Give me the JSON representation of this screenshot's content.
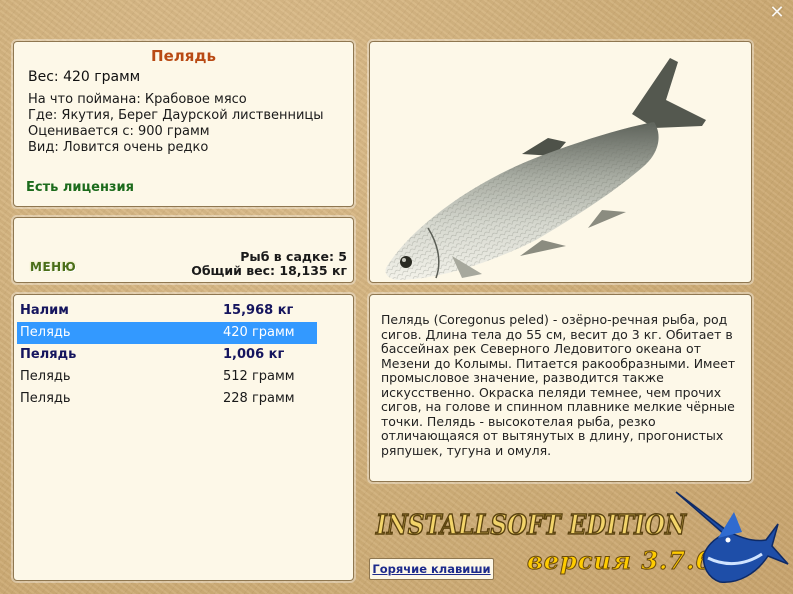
{
  "window": {
    "close_symbol": "✕"
  },
  "info": {
    "title": "Пелядь",
    "weight": "Вес: 420 грамм",
    "details": [
      "На что поймана: Крабовое мясо",
      "Где: Якутия, Берег Даурской лиственницы",
      "Оценивается с: 900 грамм",
      "Вид: Ловится очень редко"
    ],
    "license": "Есть лицензия"
  },
  "menu": {
    "button_label": "МЕНЮ",
    "fish_in_keepnet": "Рыб в садке: 5",
    "total_weight": "Общий вес: 18,135 кг"
  },
  "catch_list": [
    {
      "name": "Налим",
      "weight": "15,968 кг",
      "bold": true,
      "selected": false
    },
    {
      "name": "Пелядь",
      "weight": "420 грамм",
      "bold": false,
      "selected": true
    },
    {
      "name": "Пелядь",
      "weight": "1,006 кг",
      "bold": true,
      "selected": false
    },
    {
      "name": "Пелядь",
      "weight": "512 грамм",
      "bold": false,
      "selected": false
    },
    {
      "name": "Пелядь",
      "weight": "228 грамм",
      "bold": false,
      "selected": false
    }
  ],
  "description": "Пелядь (Coregonus peled) - озёрно-речная рыба, род сигов. Длина тела до 55 см, весит до 3 кг. Обитает в бассейнах рек Северного Ледовитого океана от Мезени до Колымы. Питается ракообразными. Имеет промысловое значение, разводится также искусственно. Окраска пеляди темнее, чем прочих сигов, на голове и спинном плавнике мелкие чёрные точки. Пелядь - высокотелая рыба, резко отличающаяся от вытянутых в длину, прогонистых ряпушек, тугуна и омуля.",
  "brand": {
    "edition": "INSTALLSOFT EDITION",
    "version": "версия 3.7.6"
  },
  "hotkeys_label": "Горячие клавиши",
  "colors": {
    "title": "#b94a14",
    "license": "#1c6b1c",
    "bold_row": "#15155e",
    "selection": "#3399ff",
    "panel": "#fdf8e8",
    "background": "#d2b27f"
  },
  "icons": {
    "fish_image": "peled-fish-icon",
    "logo_mascot": "marlin-icon",
    "close": "close-icon"
  }
}
